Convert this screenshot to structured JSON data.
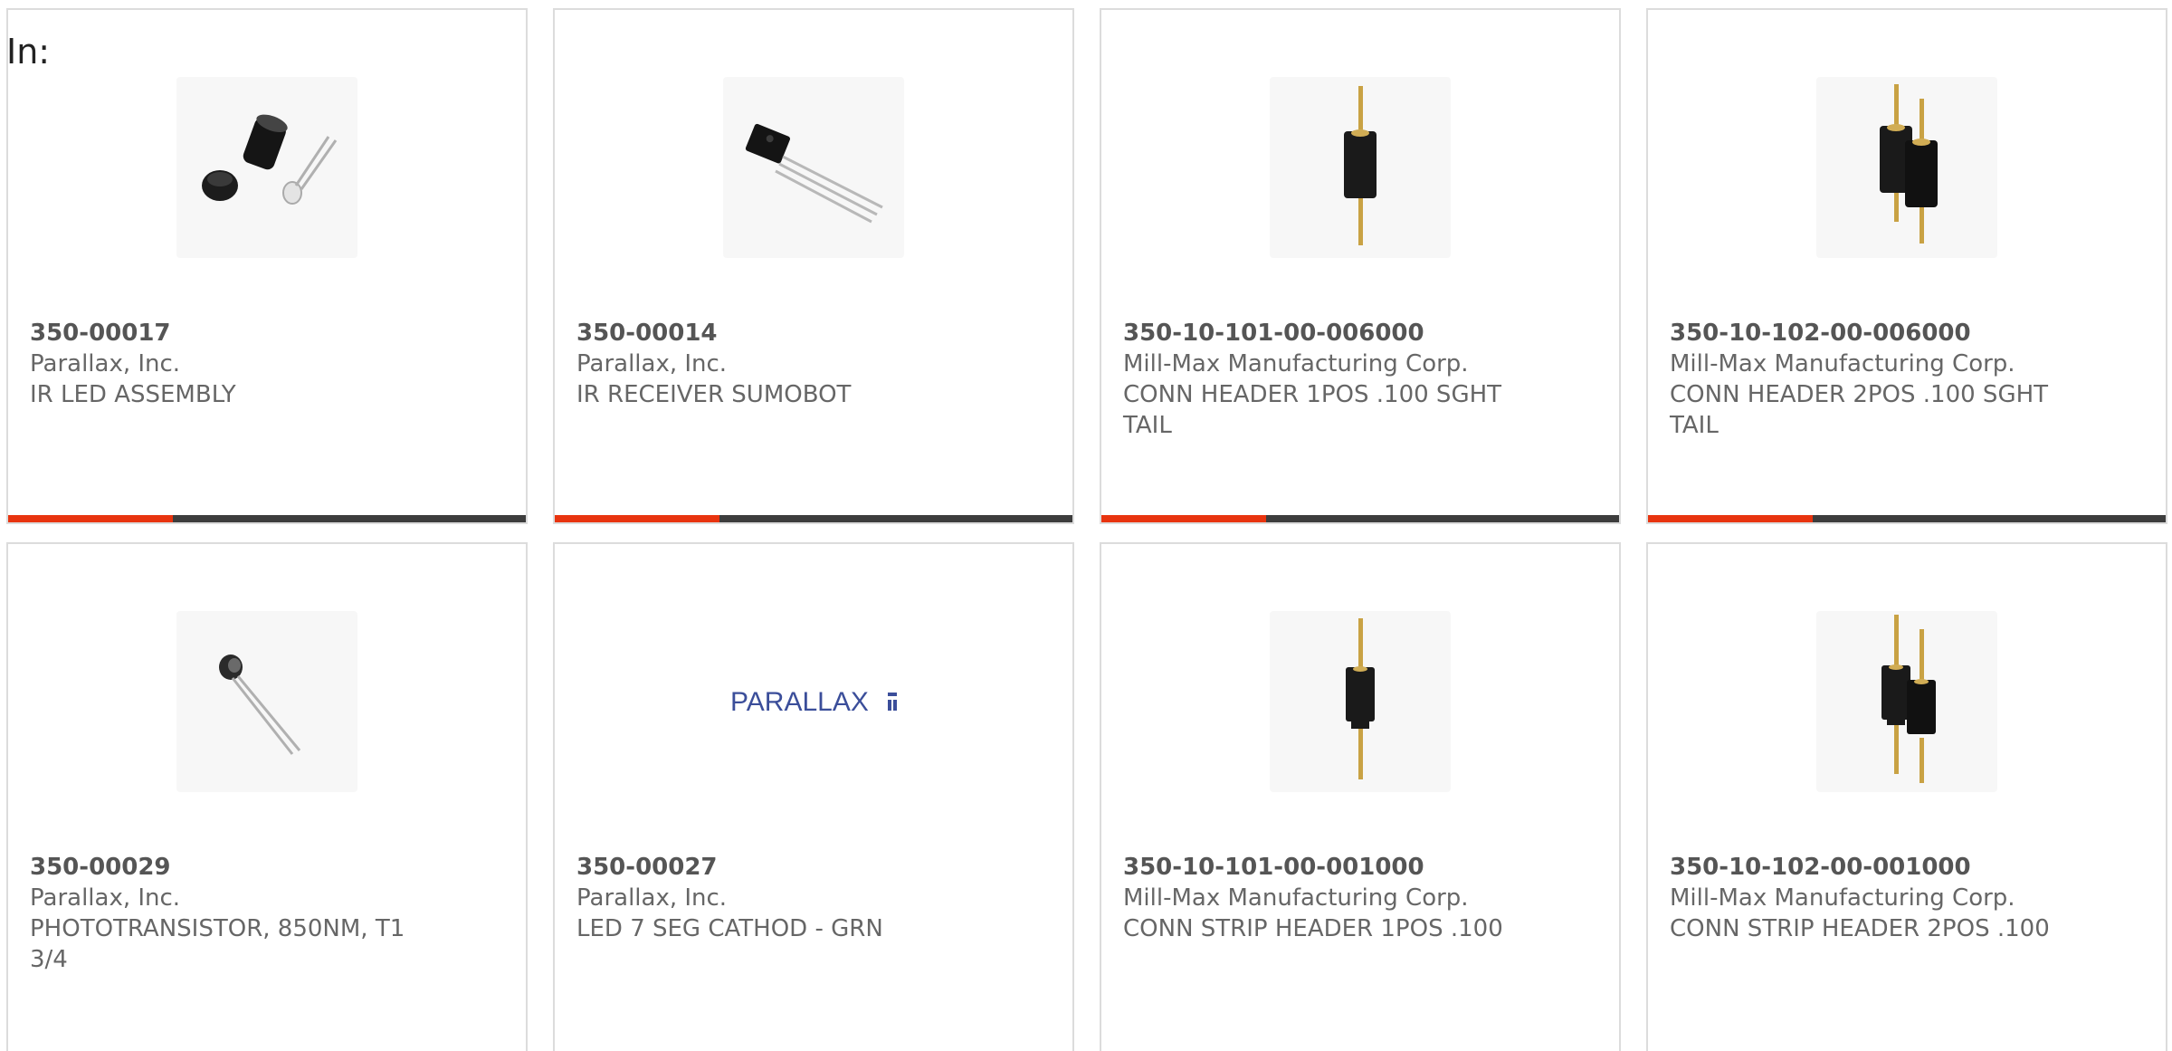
{
  "header": {
    "label": "In:"
  },
  "products": [
    {
      "part_number": "350-00017",
      "manufacturer": "Parallax, Inc.",
      "description": "IR LED ASSEMBLY",
      "image": "ir-led-assembly-image"
    },
    {
      "part_number": "350-00014",
      "manufacturer": "Parallax, Inc.",
      "description": "IR RECEIVER SUMOBOT",
      "image": "ir-receiver-image"
    },
    {
      "part_number": "350-10-101-00-006000",
      "manufacturer": "Mill-Max Manufacturing Corp.",
      "description": "CONN HEADER 1POS .100 SGHT TAIL",
      "image": "header-1pos-image"
    },
    {
      "part_number": "350-10-102-00-006000",
      "manufacturer": "Mill-Max Manufacturing Corp.",
      "description": "CONN HEADER 2POS .100 SGHT TAIL",
      "image": "header-2pos-image"
    },
    {
      "part_number": "350-00029",
      "manufacturer": "Parallax, Inc.",
      "description": "PHOTOTRANSISTOR, 850NM, T1 3/4",
      "image": "phototransistor-image"
    },
    {
      "part_number": "350-00027",
      "manufacturer": "Parallax, Inc.",
      "description": "LED 7 SEG CATHOD - GRN",
      "image": "parallax-logo-image",
      "logo_text": "PARALLAX"
    },
    {
      "part_number": "350-10-101-00-001000",
      "manufacturer": "Mill-Max Manufacturing Corp.",
      "description": "CONN STRIP HEADER 1POS .100",
      "image": "strip-header-1pos-image"
    },
    {
      "part_number": "350-10-102-00-001000",
      "manufacturer": "Mill-Max Manufacturing Corp.",
      "description": "CONN STRIP HEADER 2POS .100",
      "image": "strip-header-2pos-image"
    }
  ],
  "colors": {
    "accent": "#e8340f",
    "bar": "#3d3d3d",
    "border": "#dcdcdc",
    "logo": "#3b4e9a"
  }
}
